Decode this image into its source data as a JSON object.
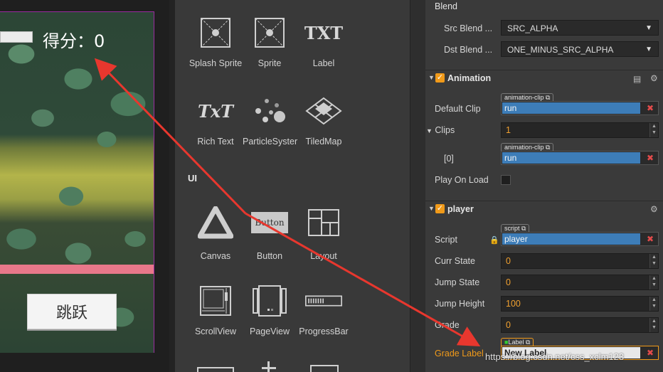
{
  "game": {
    "score_label": "得分：0",
    "jump_button": "跳跃"
  },
  "library": {
    "items_row1": [
      "Splash Sprite",
      "Sprite",
      "Label"
    ],
    "items_row2": [
      "Rich Text",
      "ParticleSyster",
      "TiledMap"
    ],
    "section_ui": "UI",
    "items_row3": [
      "Canvas",
      "Button",
      "Layout"
    ],
    "items_row4": [
      "ScrollView",
      "PageView",
      "ProgressBar"
    ],
    "txt_icon_text": "TXT",
    "richtext_icon_text": "TxT",
    "button_icon_text": "Button"
  },
  "inspector": {
    "blend_header": "Blend",
    "src_blend_label": "Src Blend ...",
    "src_blend_value": "SRC_ALPHA",
    "dst_blend_label": "Dst Blend ...",
    "dst_blend_value": "ONE_MINUS_SRC_ALPHA",
    "animation": {
      "title": "Animation",
      "default_clip_label": "Default Clip",
      "default_clip_tag": "animation-clip",
      "default_clip_value": "run",
      "clips_label": "Clips",
      "clips_count": "1",
      "clip0_label": "[0]",
      "clip0_tag": "animation-clip",
      "clip0_value": "run",
      "play_on_load_label": "Play On Load"
    },
    "player": {
      "title": "player",
      "script_label": "Script",
      "script_tag": "script",
      "script_value": "player",
      "curr_state_label": "Curr State",
      "curr_state_value": "0",
      "jump_state_label": "Jump State",
      "jump_state_value": "0",
      "jump_height_label": "Jump Height",
      "jump_height_value": "100",
      "grade_label": "Grade",
      "grade_value": "0",
      "grade_label_label": "Grade Label",
      "grade_label_tag": "Label",
      "grade_label_value": "New Label"
    }
  },
  "watermark": "https://blog.csdn.net/css_xclm123",
  "colors": {
    "accent_orange": "#f09a1a",
    "asset_blue": "#3d7db8",
    "arrow_red": "#e8372e",
    "game_border": "#9a2ba0"
  }
}
